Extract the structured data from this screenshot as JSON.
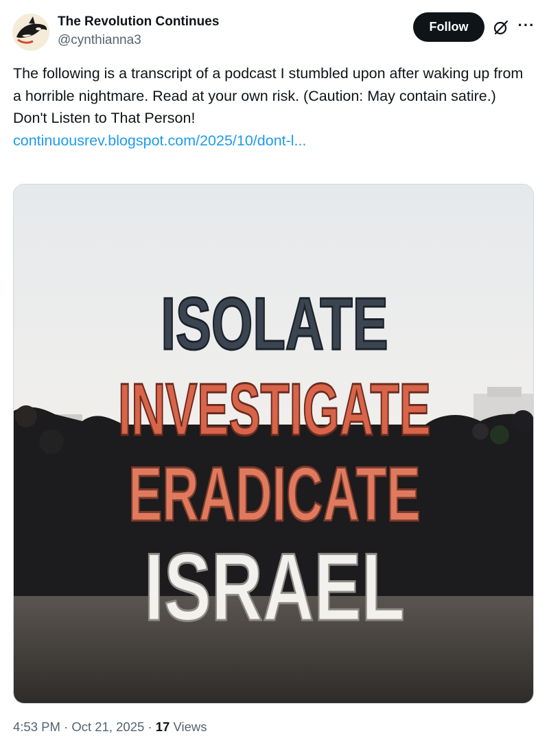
{
  "author": {
    "display_name": "The Revolution Continues",
    "handle": "@cynthianna3",
    "avatar_icon": "orca-avatar"
  },
  "actions": {
    "follow_label": "Follow",
    "grok_icon": "grok-icon",
    "more_icon": "more-options-icon",
    "more_label": "···"
  },
  "tweet": {
    "line1": "The following is a transcript of a podcast I stumbled upon after waking up from a horrible nightmare. Read at your own risk. (Caution: May contain satire.)",
    "line2": "Don't Listen to That Person!",
    "link": "continuousrev.blogspot.com/2025/10/dont-l..."
  },
  "media": {
    "words": [
      "ISOLATE",
      "INVESTIGATE",
      "ERADICATE",
      "ISRAEL"
    ]
  },
  "meta": {
    "time": "4:53 PM",
    "separator": "·",
    "date": "Oct 21, 2025",
    "views_count": "17",
    "views_label": "Views"
  },
  "colors": {
    "link": "#1d9bf0",
    "follow_bg": "#0f1419",
    "secondary_text": "#536471"
  }
}
